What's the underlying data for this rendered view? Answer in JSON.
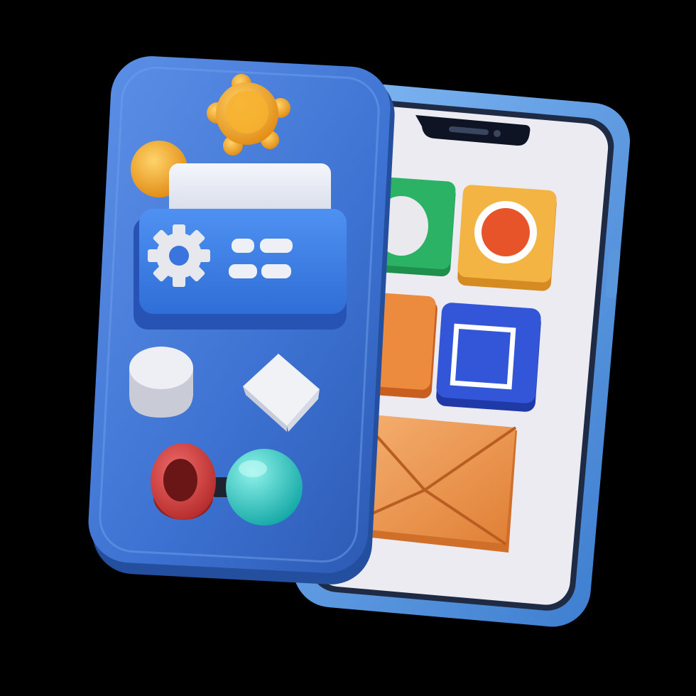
{
  "scene": {
    "background": "#000000",
    "colors": {
      "back_phone_frame": "#5b9be0",
      "back_phone_screen": "#ececf2",
      "front_panel": "#3f78d6",
      "front_panel_dark": "#2f5fb8",
      "settings_card": "#3d80e8",
      "green_tile": "#22a05a",
      "yellow_tile": "#f0aa3a",
      "orange_tile": "#e8823a",
      "blue_tile": "#2f52d0",
      "envelope": "#f09a4e",
      "gold": "#f2a223",
      "red_ring": "#cc3a3a",
      "teal_ball": "#2ac7c2",
      "white_shape": "#ececef"
    },
    "icons": [
      "gear-icon",
      "menu-icon",
      "envelope-icon",
      "sun-icon",
      "cylinder-icon",
      "cube-icon",
      "joystick-icon"
    ]
  }
}
